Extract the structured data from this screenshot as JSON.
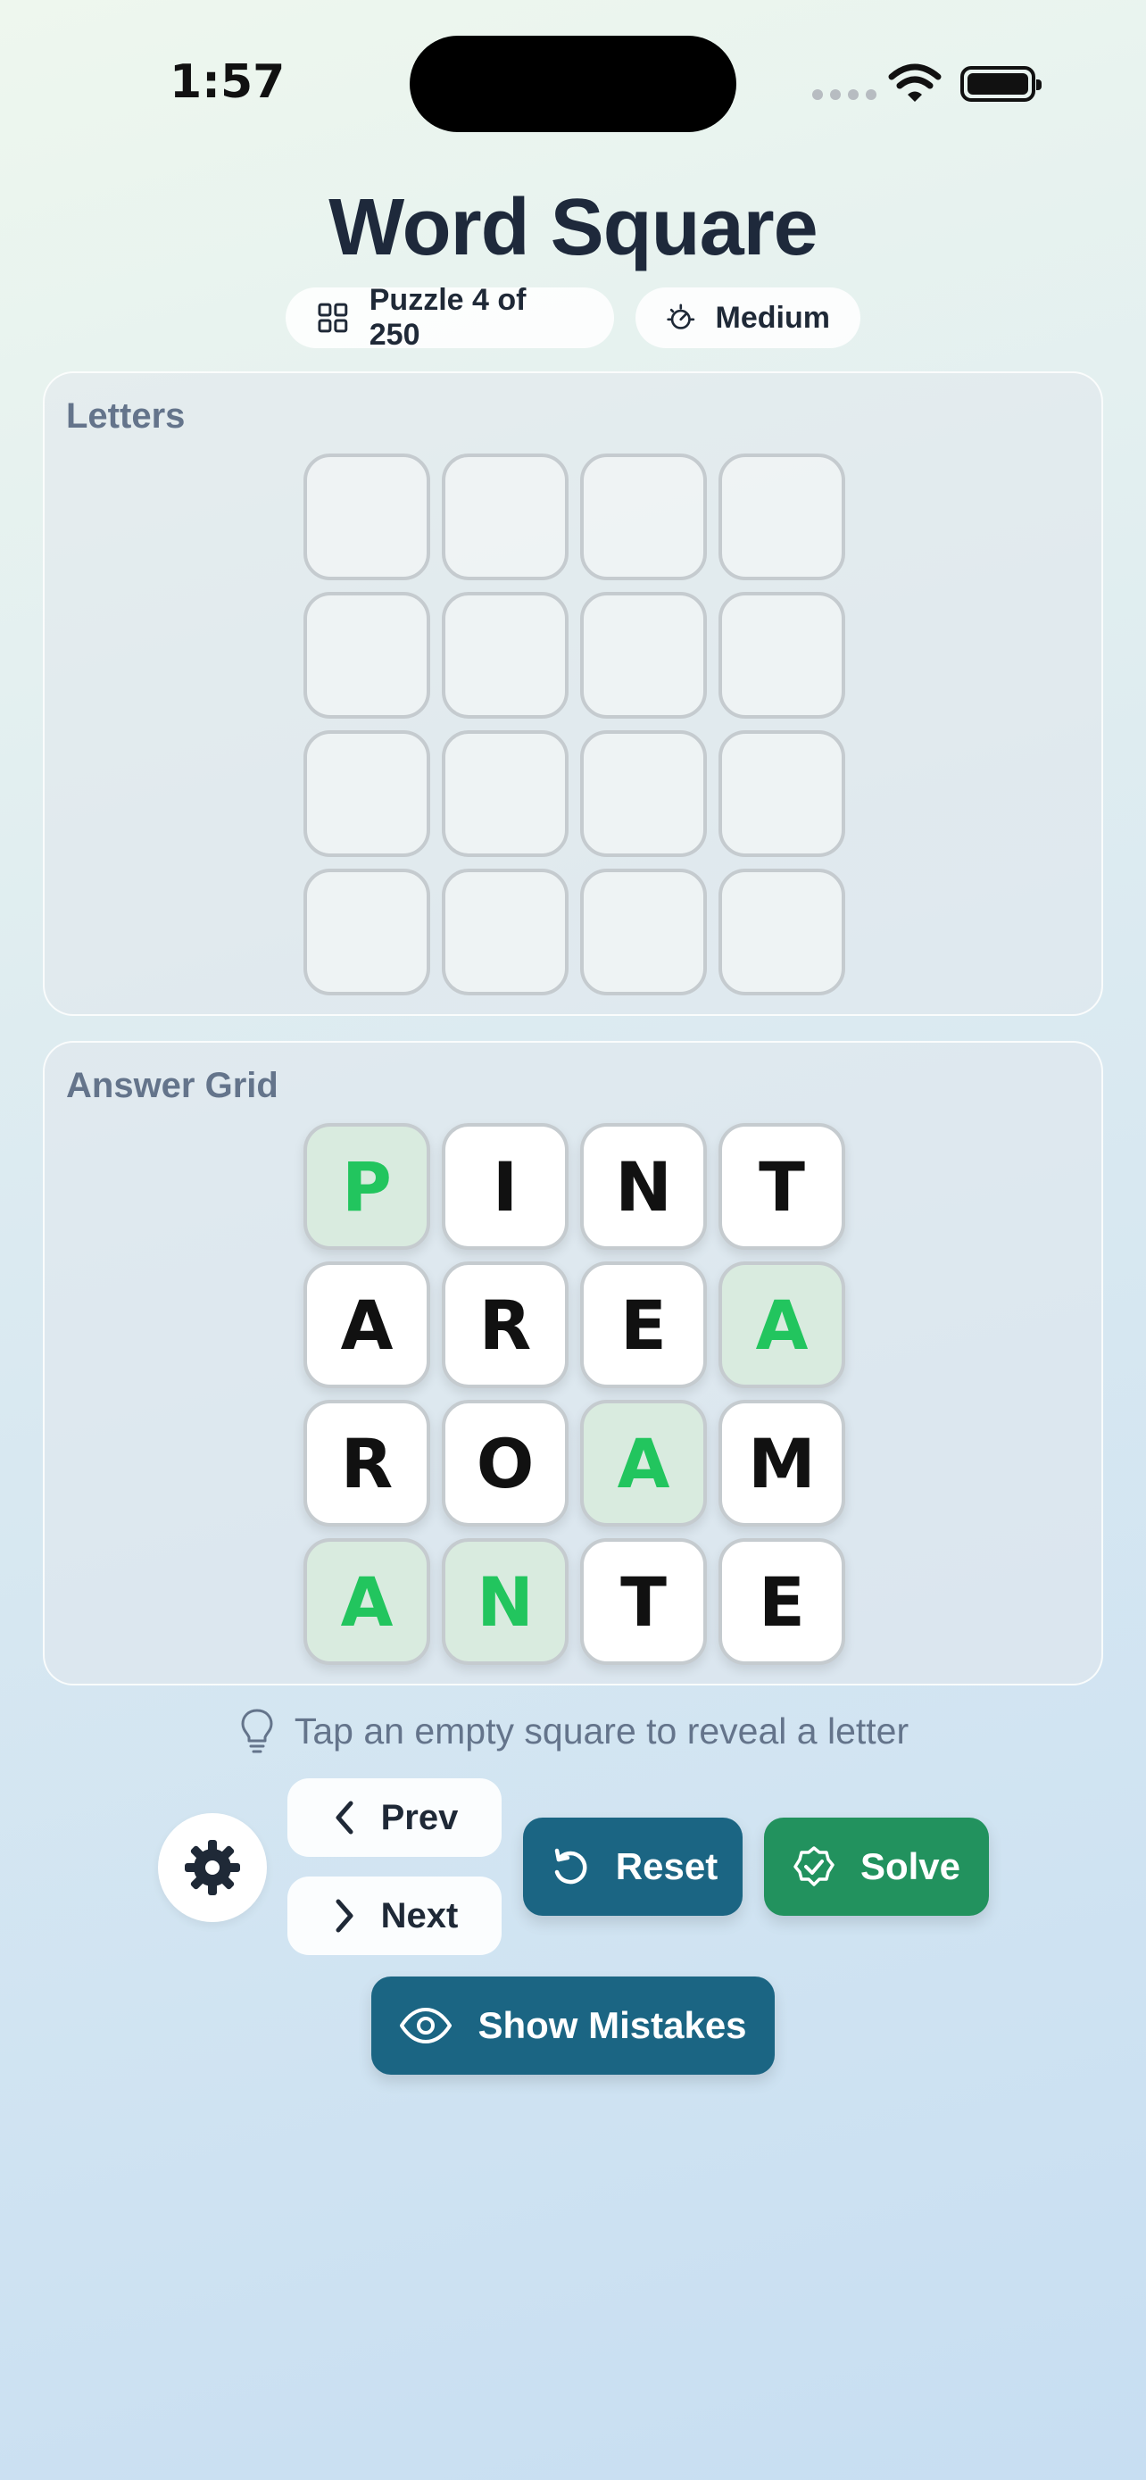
{
  "status_bar": {
    "time": "1:57"
  },
  "header": {
    "title": "Word Square",
    "puzzle_label": "Puzzle 4 of 250",
    "difficulty_label": "Medium"
  },
  "letters_panel": {
    "label": "Letters",
    "tiles": [
      "",
      "",
      "",
      "",
      "",
      "",
      "",
      "",
      "",
      "",
      "",
      "",
      "",
      "",
      "",
      ""
    ]
  },
  "answer_panel": {
    "label": "Answer Grid",
    "rows": [
      [
        {
          "letter": "P",
          "revealed": true
        },
        {
          "letter": "I",
          "revealed": false
        },
        {
          "letter": "N",
          "revealed": false
        },
        {
          "letter": "T",
          "revealed": false
        }
      ],
      [
        {
          "letter": "A",
          "revealed": false
        },
        {
          "letter": "R",
          "revealed": false
        },
        {
          "letter": "E",
          "revealed": false
        },
        {
          "letter": "A",
          "revealed": true
        }
      ],
      [
        {
          "letter": "R",
          "revealed": false
        },
        {
          "letter": "O",
          "revealed": false
        },
        {
          "letter": "A",
          "revealed": true
        },
        {
          "letter": "M",
          "revealed": false
        }
      ],
      [
        {
          "letter": "A",
          "revealed": true
        },
        {
          "letter": "N",
          "revealed": true
        },
        {
          "letter": "T",
          "revealed": false
        },
        {
          "letter": "E",
          "revealed": false
        }
      ]
    ]
  },
  "hint": "Tap an empty square to reveal a letter",
  "controls": {
    "prev_label": "Prev",
    "next_label": "Next",
    "reset_label": "Reset",
    "solve_label": "Solve",
    "show_mistakes_label": "Show Mistakes"
  },
  "icons": {
    "settings": "gear-icon",
    "puzzle": "grid-icon",
    "difficulty": "gauge-icon",
    "hint": "lightbulb-icon",
    "prev": "chevron-left-icon",
    "next": "chevron-right-icon",
    "reset": "rotate-ccw-icon",
    "solve": "badge-check-icon",
    "show_mistakes": "eye-icon"
  },
  "colors": {
    "primary_button": "#1b6583",
    "solve_button": "#22925e",
    "revealed_letter": "#22c55e",
    "revealed_tile": "#d9ebdf"
  }
}
